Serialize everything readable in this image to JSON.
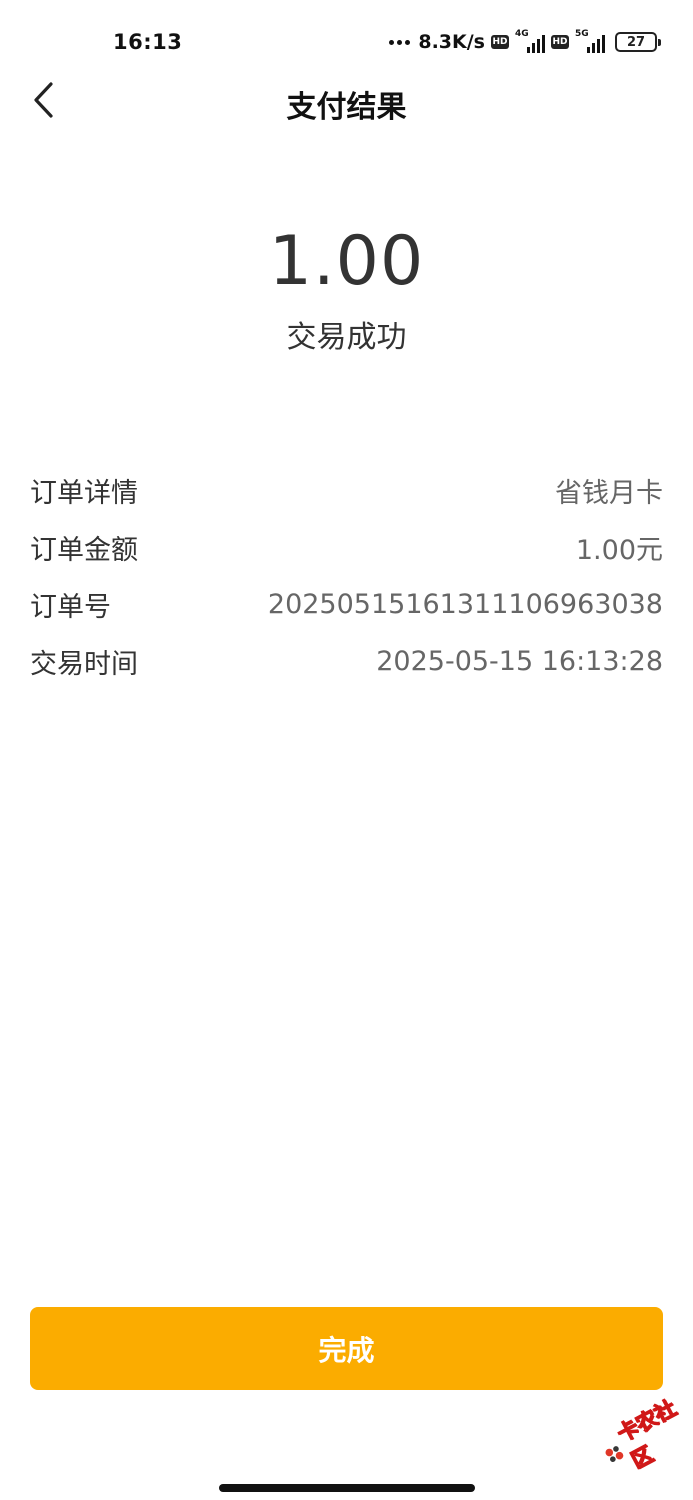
{
  "status_bar": {
    "time": "16:13",
    "net_speed": "8.3K/s",
    "hd_label": "HD",
    "network_1": "4G",
    "network_2": "5G",
    "battery_level": "27"
  },
  "header": {
    "back_icon": "chevron-left-icon",
    "title": "支付结果"
  },
  "result": {
    "amount": "1.00",
    "status": "交易成功"
  },
  "details": [
    {
      "label": "订单详情",
      "value": "省钱月卡"
    },
    {
      "label": "订单金额",
      "value": "1.00元"
    },
    {
      "label": "订单号",
      "value": "20250515161311106963038"
    },
    {
      "label": "交易时间",
      "value": "2025-05-15 16:13:28"
    }
  ],
  "actions": {
    "done_label": "完成"
  },
  "watermark": {
    "text": "卡农社区"
  },
  "colors": {
    "accent": "#fbac00",
    "text_primary": "#333333",
    "text_secondary": "#666666"
  }
}
